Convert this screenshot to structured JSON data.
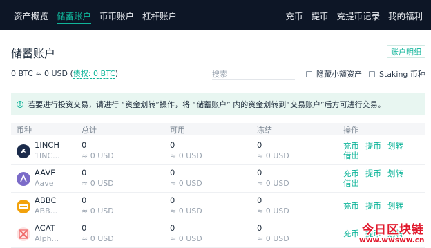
{
  "nav": {
    "left": [
      "资产概览",
      "储蓄账户",
      "币币账户",
      "杠杆账户"
    ],
    "right": [
      "充币",
      "提币",
      "充提币记录",
      "我的福利"
    ],
    "active_index": 1
  },
  "page": {
    "title": "储蓄账户",
    "detail_button": "账户明细"
  },
  "balance": {
    "prefix": "0 BTC ≈ 0 USD (",
    "debt_label": "债权: 0 BTC",
    "suffix": ")",
    "search_placeholder": "搜索",
    "hide_small": "隐藏小额资产",
    "staking": "Staking 币种"
  },
  "notice": {
    "icon": "info-icon",
    "text": "若要进行投资交易，请进行 “资金划转”操作，将 “储蓄账户” 内的资金划转到“交易账户”后方可进行交易。"
  },
  "table": {
    "headers": [
      "币种",
      "总计",
      "可用",
      "冻结",
      "操作"
    ],
    "rows": [
      {
        "symbol": "1INCH",
        "name": "1INC...",
        "icon_color": "#1b2b4b",
        "icon_glyph": "🦄",
        "total": "0",
        "total_usd": "≈ 0 USD",
        "available": "0",
        "available_usd": "≈ 0 USD",
        "frozen": "0",
        "frozen_usd": "≈ 0 USD",
        "actions": [
          "充币",
          "提币",
          "划转",
          "借出"
        ]
      },
      {
        "symbol": "AAVE",
        "name": "Aave",
        "icon_color": "#7b6bc8",
        "icon_glyph": "A",
        "total": "0",
        "total_usd": "≈ 0 USD",
        "available": "0",
        "available_usd": "≈ 0 USD",
        "frozen": "0",
        "frozen_usd": "≈ 0 USD",
        "actions": [
          "充币",
          "提币",
          "划转",
          "借出"
        ]
      },
      {
        "symbol": "ABBC",
        "name": "ABB...",
        "icon_color": "#f2a20c",
        "icon_glyph": "abbc",
        "total": "0",
        "total_usd": "≈ 0 USD",
        "available": "0",
        "available_usd": "≈ 0 USD",
        "frozen": "0",
        "frozen_usd": "≈ 0 USD",
        "actions": [
          "充币",
          "提币",
          "划转"
        ]
      },
      {
        "symbol": "ACAT",
        "name": "Alph...",
        "icon_color": "#f06a6a",
        "icon_glyph": "⊠",
        "total": "0",
        "total_usd": "≈ 0 USD",
        "available": "0",
        "available_usd": "≈ 0 USD",
        "frozen": "0",
        "frozen_usd": "≈ 0 USD",
        "actions": [
          "充币",
          "提币",
          "划转"
        ]
      }
    ]
  },
  "watermark": {
    "line1": "今日区块链",
    "line2": "www.wwsww.cn"
  },
  "colors": {
    "accent": "#10b59a",
    "nav_bg": "#0d1626",
    "notice_bg": "#e8f6f1"
  }
}
